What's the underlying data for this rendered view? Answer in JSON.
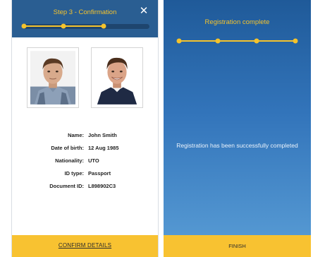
{
  "confirmation": {
    "title": "Step 3 - Confirmation",
    "close_icon": "close-icon",
    "progress_fraction": 0.76,
    "details": [
      {
        "label": "Name:",
        "value": "John Smith"
      },
      {
        "label": "Date of birth:",
        "value": "12 Aug 1985"
      },
      {
        "label": "Nationality:",
        "value": "UTO"
      },
      {
        "label": "ID type:",
        "value": "Passport"
      },
      {
        "label": "Document ID:",
        "value": "L898902C3"
      }
    ],
    "confirm_label": "CONFIRM DETAILS"
  },
  "complete": {
    "title": "Registration complete",
    "message": "Registration has been successfully completed",
    "finish_label": "FINISH"
  },
  "colors": {
    "header_blue": "#2a5e92",
    "accent_yellow": "#f8c231",
    "gradient_top": "#1f5a99",
    "gradient_bottom": "#5a9ed6"
  }
}
